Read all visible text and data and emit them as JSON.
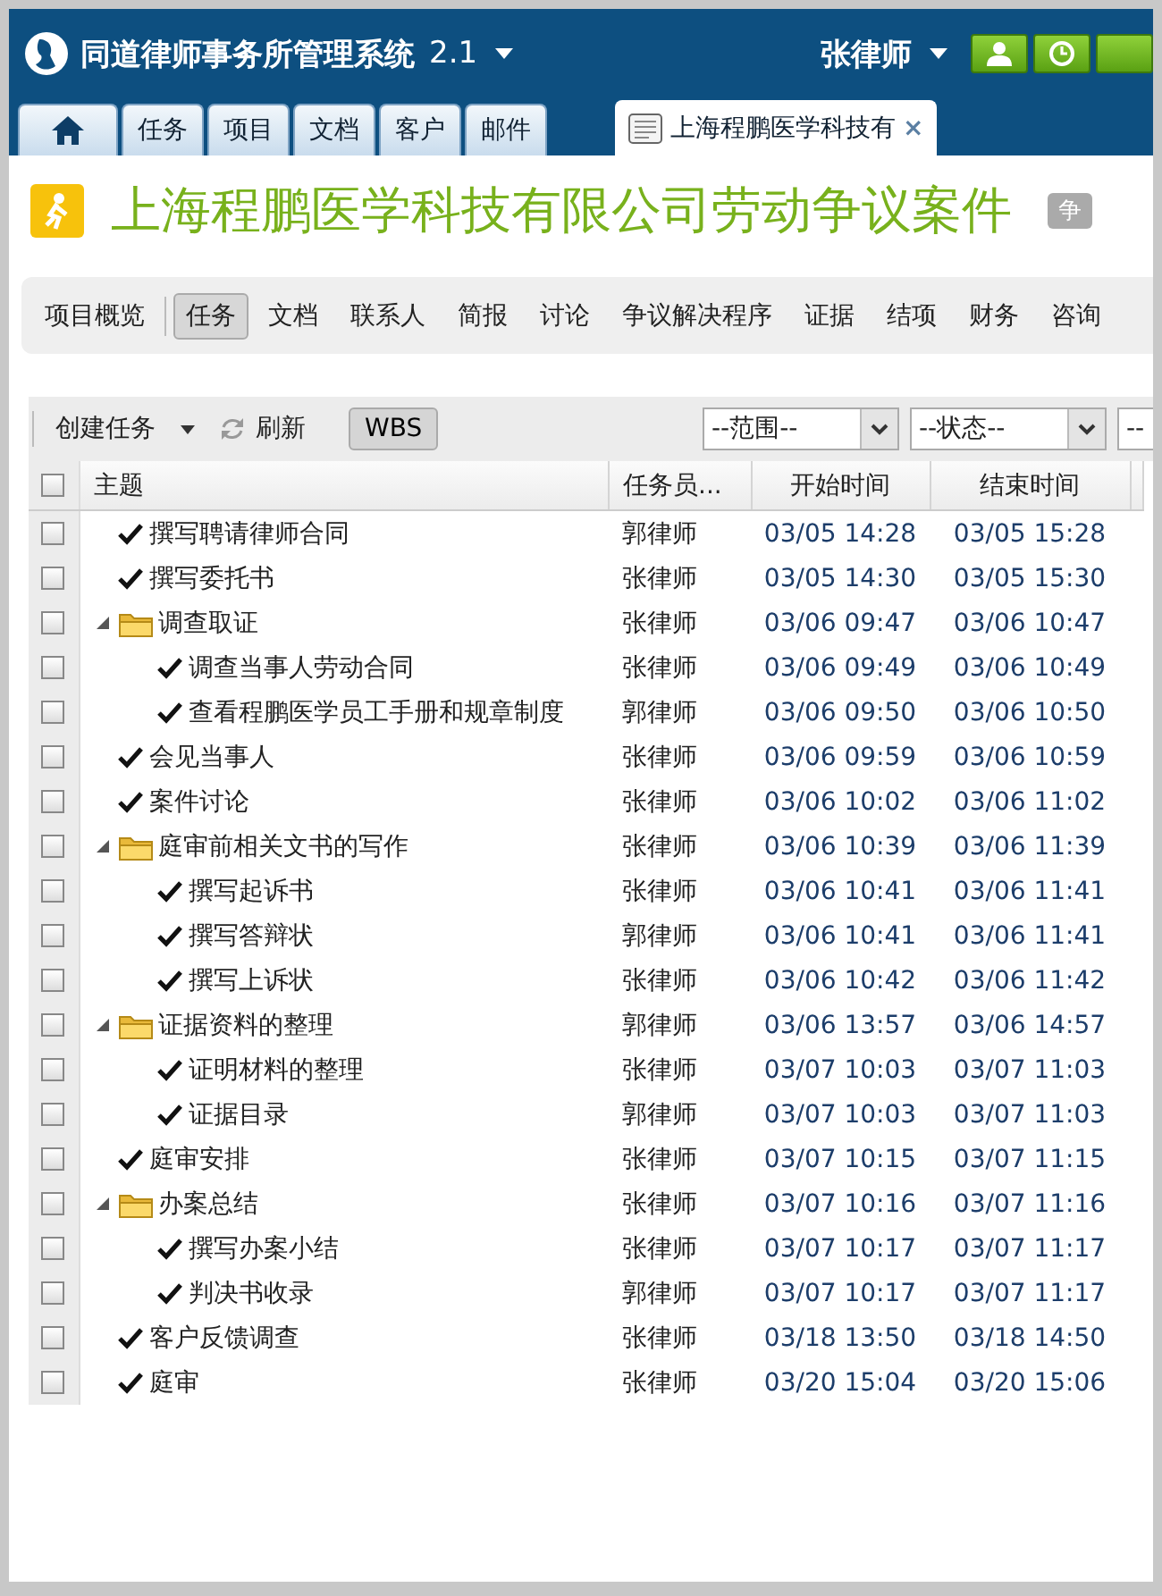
{
  "app": {
    "title": "同道律师事务所管理系统",
    "version": "2.1",
    "user": "张律师"
  },
  "tabs": [
    {
      "kind": "home",
      "selected": false
    },
    {
      "kind": "text",
      "label": "任务",
      "selected": false
    },
    {
      "kind": "text",
      "label": "项目",
      "selected": false
    },
    {
      "kind": "text",
      "label": "文档",
      "selected": false
    },
    {
      "kind": "text",
      "label": "客户",
      "selected": false
    },
    {
      "kind": "text",
      "label": "邮件",
      "selected": false
    },
    {
      "kind": "document",
      "label": "上海程鹏医学科技有",
      "close": "×",
      "selected": true
    }
  ],
  "project": {
    "title": "上海程鹏医学科技有限公司劳动争议案件",
    "badge": "争"
  },
  "nav": [
    {
      "label": "项目概览",
      "selected": false
    },
    {
      "label": "任务",
      "selected": true
    },
    {
      "label": "文档",
      "selected": false
    },
    {
      "label": "联系人",
      "selected": false
    },
    {
      "label": "简报",
      "selected": false
    },
    {
      "label": "讨论",
      "selected": false
    },
    {
      "label": "争议解决程序",
      "selected": false
    },
    {
      "label": "证据",
      "selected": false
    },
    {
      "label": "结项",
      "selected": false
    },
    {
      "label": "财务",
      "selected": false
    },
    {
      "label": "咨询",
      "selected": false
    }
  ],
  "toolbar": {
    "create": "创建任务",
    "refresh": "刷新",
    "wbs": "WBS",
    "filters": [
      {
        "value": "--范围--"
      },
      {
        "value": "--状态--"
      },
      {
        "value": "--"
      }
    ]
  },
  "table": {
    "columns": [
      "主题",
      "任务员...",
      "开始时间",
      "结束时间"
    ],
    "all_checked": false,
    "rows": [
      {
        "kind": "task",
        "title": "撰写聘请律师合同",
        "assignee": "郭律师",
        "start": "03/05 14:28",
        "end": "03/05 15:28",
        "checked": false
      },
      {
        "kind": "task",
        "title": "撰写委托书",
        "assignee": "张律师",
        "start": "03/05 14:30",
        "end": "03/05 15:30",
        "checked": false
      },
      {
        "kind": "group",
        "title": "调查取证",
        "assignee": "张律师",
        "start": "03/06 09:47",
        "end": "03/06 10:47",
        "checked": false,
        "expanded": true,
        "children": [
          {
            "kind": "task",
            "title": "调查当事人劳动合同",
            "assignee": "张律师",
            "start": "03/06 09:49",
            "end": "03/06 10:49",
            "checked": false
          },
          {
            "kind": "task",
            "title": "查看程鹏医学员工手册和规章制度",
            "assignee": "郭律师",
            "start": "03/06 09:50",
            "end": "03/06 10:50",
            "checked": false
          }
        ]
      },
      {
        "kind": "task",
        "title": "会见当事人",
        "assignee": "张律师",
        "start": "03/06 09:59",
        "end": "03/06 10:59",
        "checked": false
      },
      {
        "kind": "task",
        "title": "案件讨论",
        "assignee": "张律师",
        "start": "03/06 10:02",
        "end": "03/06 11:02",
        "checked": false
      },
      {
        "kind": "group",
        "title": "庭审前相关文书的写作",
        "assignee": "张律师",
        "start": "03/06 10:39",
        "end": "03/06 11:39",
        "checked": false,
        "expanded": true,
        "children": [
          {
            "kind": "task",
            "title": "撰写起诉书",
            "assignee": "张律师",
            "start": "03/06 10:41",
            "end": "03/06 11:41",
            "checked": false
          },
          {
            "kind": "task",
            "title": "撰写答辩状",
            "assignee": "郭律师",
            "start": "03/06 10:41",
            "end": "03/06 11:41",
            "checked": false
          },
          {
            "kind": "task",
            "title": "撰写上诉状",
            "assignee": "张律师",
            "start": "03/06 10:42",
            "end": "03/06 11:42",
            "checked": false
          }
        ]
      },
      {
        "kind": "group",
        "title": "证据资料的整理",
        "assignee": "郭律师",
        "start": "03/06 13:57",
        "end": "03/06 14:57",
        "checked": false,
        "expanded": true,
        "children": [
          {
            "kind": "task",
            "title": "证明材料的整理",
            "assignee": "张律师",
            "start": "03/07 10:03",
            "end": "03/07 11:03",
            "checked": false
          },
          {
            "kind": "task",
            "title": "证据目录",
            "assignee": "郭律师",
            "start": "03/07 10:03",
            "end": "03/07 11:03",
            "checked": false
          }
        ]
      },
      {
        "kind": "task",
        "title": "庭审安排",
        "assignee": "张律师",
        "start": "03/07 10:15",
        "end": "03/07 11:15",
        "checked": false
      },
      {
        "kind": "group",
        "title": "办案总结",
        "assignee": "张律师",
        "start": "03/07 10:16",
        "end": "03/07 11:16",
        "checked": false,
        "expanded": true,
        "children": [
          {
            "kind": "task",
            "title": "撰写办案小结",
            "assignee": "张律师",
            "start": "03/07 10:17",
            "end": "03/07 11:17",
            "checked": false
          },
          {
            "kind": "task",
            "title": "判决书收录",
            "assignee": "郭律师",
            "start": "03/07 10:17",
            "end": "03/07 11:17",
            "checked": false
          }
        ]
      },
      {
        "kind": "task",
        "title": "客户反馈调查",
        "assignee": "张律师",
        "start": "03/18 13:50",
        "end": "03/18 14:50",
        "checked": false
      },
      {
        "kind": "task",
        "title": "庭审",
        "assignee": "张律师",
        "start": "03/20 15:04",
        "end": "03/20 15:06",
        "checked": false
      }
    ]
  }
}
